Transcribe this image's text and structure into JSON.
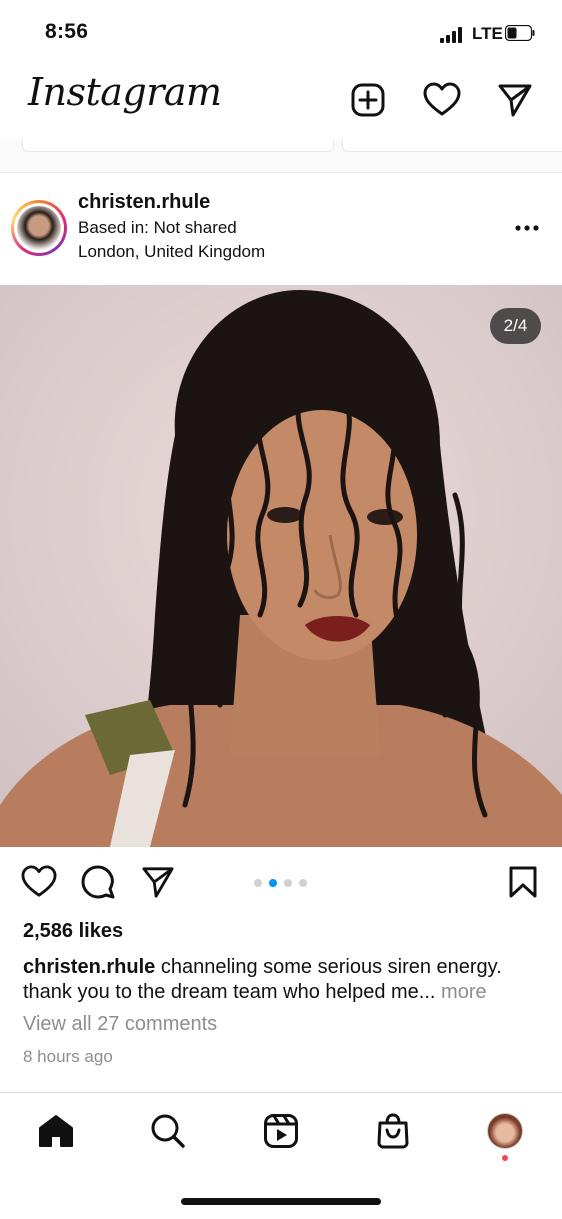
{
  "status_bar": {
    "time": "8:56",
    "network": "LTE",
    "battery_level": 0.25
  },
  "header": {
    "logo": "Instagram",
    "icons": [
      "add-post-icon",
      "heart-icon",
      "direct-message-icon"
    ]
  },
  "post": {
    "username": "christen.rhule",
    "based_in": "Based in: Not shared",
    "location": "London, United Kingdom",
    "carousel": {
      "label": "2/4",
      "current": 2,
      "total": 4
    },
    "likes": "2,586 likes",
    "caption_user": "christen.rhule",
    "caption_text": "channeling some serious siren energy. thank you to the dream team who helped me...",
    "caption_more": "more",
    "comments_link": "View all 27 comments",
    "timestamp": "8 hours ago"
  },
  "bottom_nav": {
    "items": [
      "home-icon",
      "search-icon",
      "reels-icon",
      "shop-icon",
      "profile-avatar"
    ],
    "active": "home-icon",
    "notification_color": "#ed4956"
  },
  "colors": {
    "accent": "#0095f6",
    "secondary_text": "#8e8e8e"
  }
}
